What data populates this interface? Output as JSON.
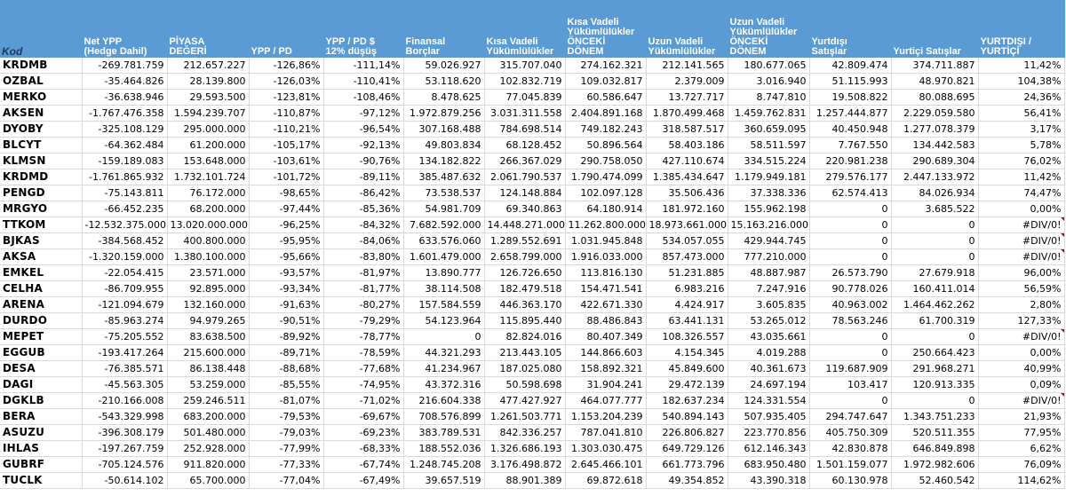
{
  "headers": [
    "Kod",
    "Net YPP\n(Hedge Dahil)",
    "PİYASA\nDEĞERİ",
    "YPP / PD",
    "YPP / PD $\n12% düşüş",
    "Finansal\nBorçlar",
    "Kısa Vadeli\nYükümlülükler",
    "Kısa Vadeli\nYükümlülükler\nÖNCEKİ\nDÖNEM",
    "Uzun Vadeli\nYükümlülükler",
    "Uzun Vadeli\nYükümlülükler\nÖNCEKİ\nDÖNEM",
    "Yurtdışı\nSatışlar",
    "Yurtiçi Satışlar",
    "YURTDIŞI /\nYURTİÇİ"
  ],
  "rows": [
    [
      "KRDMB",
      "-269.781.759",
      "212.657.227",
      "-126,86%",
      "-111,14%",
      "59.026.927",
      "315.707.040",
      "274.162.321",
      "212.141.565",
      "180.677.065",
      "42.809.474",
      "374.711.887",
      "11,42%"
    ],
    [
      "OZBAL",
      "-35.464.826",
      "28.139.800",
      "-126,03%",
      "-110,41%",
      "53.118.620",
      "102.832.719",
      "109.032.817",
      "2.379.009",
      "3.016.940",
      "51.115.993",
      "48.970.821",
      "104,38%"
    ],
    [
      "MERKO",
      "-36.638.946",
      "29.593.500",
      "-123,81%",
      "-108,46%",
      "8.478.625",
      "77.045.839",
      "60.586.647",
      "13.727.717",
      "8.747.810",
      "19.508.822",
      "80.088.695",
      "24,36%"
    ],
    [
      "AKSEN",
      "-1.767.476.358",
      "1.594.239.707",
      "-110,87%",
      "-97,12%",
      "1.972.879.256",
      "3.031.311.558",
      "2.404.891.168",
      "1.870.499.468",
      "1.459.762.831",
      "1.257.444.877",
      "2.229.059.580",
      "56,41%"
    ],
    [
      "DYOBY",
      "-325.108.129",
      "295.000.000",
      "-110,21%",
      "-96,54%",
      "307.168.488",
      "784.698.514",
      "749.182.243",
      "318.587.517",
      "360.659.095",
      "40.450.948",
      "1.277.078.379",
      "3,17%"
    ],
    [
      "BLCYT",
      "-64.362.484",
      "61.200.000",
      "-105,17%",
      "-92,13%",
      "49.803.834",
      "68.128.452",
      "50.896.564",
      "58.403.186",
      "58.511.597",
      "7.767.550",
      "134.442.583",
      "5,78%"
    ],
    [
      "KLMSN",
      "-159.189.083",
      "153.648.000",
      "-103,61%",
      "-90,76%",
      "134.182.822",
      "266.367.029",
      "290.758.050",
      "427.110.674",
      "334.515.224",
      "220.981.238",
      "290.689.304",
      "76,02%"
    ],
    [
      "KRDMD",
      "-1.761.865.932",
      "1.732.101.724",
      "-101,72%",
      "-89,11%",
      "385.487.632",
      "2.061.790.537",
      "1.790.474.099",
      "1.385.434.647",
      "1.179.949.181",
      "279.576.177",
      "2.447.133.972",
      "11,42%"
    ],
    [
      "PENGD",
      "-75.143.811",
      "76.172.000",
      "-98,65%",
      "-86,42%",
      "73.538.537",
      "124.148.884",
      "102.097.128",
      "35.506.436",
      "37.338.336",
      "62.574.413",
      "84.026.934",
      "74,47%"
    ],
    [
      "MRGYO",
      "-66.452.235",
      "68.200.000",
      "-97,44%",
      "-85,36%",
      "54.981.709",
      "69.340.863",
      "64.180.914",
      "181.972.160",
      "155.962.198",
      "0",
      "3.685.522",
      "0,00%"
    ],
    [
      "TTKOM",
      "-12.532.375.000",
      "13.020.000.000",
      "-96,25%",
      "-84,32%",
      "7.682.592.000",
      "14.448.271.000",
      "11.262.800.000",
      "18.973.661.000",
      "15.163.216.000",
      "0",
      "0",
      "#DIV/0!"
    ],
    [
      "BJKAS",
      "-384.568.452",
      "400.800.000",
      "-95,95%",
      "-84,06%",
      "633.576.060",
      "1.289.552.691",
      "1.031.945.848",
      "534.057.055",
      "429.944.745",
      "0",
      "0",
      "#DIV/0!"
    ],
    [
      "AKSA",
      "-1.320.159.000",
      "1.380.100.000",
      "-95,66%",
      "-83,80%",
      "1.601.479.000",
      "2.658.799.000",
      "1.916.033.000",
      "857.473.000",
      "777.210.000",
      "0",
      "0",
      "#DIV/0!"
    ],
    [
      "EMKEL",
      "-22.054.415",
      "23.571.000",
      "-93,57%",
      "-81,97%",
      "13.890.777",
      "126.726.650",
      "113.816.130",
      "51.231.885",
      "48.887.987",
      "26.573.790",
      "27.679.918",
      "96,00%"
    ],
    [
      "CELHA",
      "-86.709.955",
      "92.895.000",
      "-93,34%",
      "-81,77%",
      "38.114.508",
      "182.479.518",
      "154.471.541",
      "6.983.216",
      "7.247.916",
      "90.778.026",
      "160.411.014",
      "56,59%"
    ],
    [
      "ARENA",
      "-121.094.679",
      "132.160.000",
      "-91,63%",
      "-80,27%",
      "157.584.559",
      "446.363.170",
      "422.671.330",
      "4.424.917",
      "3.605.835",
      "40.963.002",
      "1.464.462.262",
      "2,80%"
    ],
    [
      "DURDO",
      "-85.963.274",
      "94.979.265",
      "-90,51%",
      "-79,29%",
      "54.123.964",
      "115.895.440",
      "88.486.843",
      "63.441.131",
      "53.265.012",
      "78.563.246",
      "61.700.319",
      "127,33%"
    ],
    [
      "MEPET",
      "-75.205.552",
      "83.638.500",
      "-89,92%",
      "-78,77%",
      "0",
      "82.824.016",
      "80.407.349",
      "108.326.557",
      "43.035.661",
      "0",
      "0",
      "#DIV/0!"
    ],
    [
      "EGGUB",
      "-193.417.264",
      "215.600.000",
      "-89,71%",
      "-78,59%",
      "44.321.293",
      "213.443.105",
      "144.866.603",
      "4.154.345",
      "4.019.288",
      "0",
      "250.664.423",
      "0,00%"
    ],
    [
      "DESA",
      "-76.385.571",
      "86.138.448",
      "-88,68%",
      "-77,68%",
      "41.234.967",
      "187.025.080",
      "158.892.321",
      "45.849.600",
      "40.361.673",
      "119.687.909",
      "291.968.271",
      "40,99%"
    ],
    [
      "DAGI",
      "-45.563.305",
      "53.259.000",
      "-85,55%",
      "-74,95%",
      "43.372.316",
      "50.598.698",
      "31.904.241",
      "29.472.139",
      "24.697.194",
      "103.417",
      "120.913.335",
      "0,09%"
    ],
    [
      "DGKLB",
      "-210.166.008",
      "259.246.511",
      "-81,07%",
      "-71,02%",
      "216.604.338",
      "477.427.927",
      "464.077.777",
      "182.637.234",
      "124.331.554",
      "0",
      "0",
      "#DIV/0!"
    ],
    [
      "BERA",
      "-543.329.998",
      "683.200.000",
      "-79,53%",
      "-69,67%",
      "708.576.899",
      "1.261.503.771",
      "1.153.204.239",
      "540.894.143",
      "507.935.405",
      "294.747.647",
      "1.343.751.233",
      "21,93%"
    ],
    [
      "ASUZU",
      "-396.308.179",
      "501.480.000",
      "-79,03%",
      "-69,23%",
      "383.789.531",
      "842.336.257",
      "787.041.810",
      "226.806.827",
      "223.770.856",
      "405.750.309",
      "520.511.355",
      "77,95%"
    ],
    [
      "IHLAS",
      "-197.267.759",
      "252.928.000",
      "-77,99%",
      "-68,33%",
      "188.552.036",
      "1.326.686.193",
      "1.303.030.475",
      "649.729.126",
      "612.146.343",
      "42.830.878",
      "646.849.898",
      "6,62%"
    ],
    [
      "GUBRF",
      "-705.124.576",
      "911.820.000",
      "-77,33%",
      "-67,74%",
      "1.248.745.208",
      "3.176.498.872",
      "2.645.466.101",
      "661.773.796",
      "683.950.480",
      "1.501.159.077",
      "1.972.982.606",
      "76,09%"
    ],
    [
      "TUCLK",
      "-50.614.102",
      "65.700.000",
      "-77,04%",
      "-67,49%",
      "39.657.519",
      "88.901.389",
      "69.872.618",
      "49.354.852",
      "43.390.318",
      "60.130.978",
      "52.460.542",
      "114,62%"
    ]
  ],
  "colors": {
    "header_bg": "#5B9BD5",
    "header_text": "#FFFFFF",
    "kod_header_text": "#1F3864",
    "error_marker": "#C00000",
    "grid": "#D9D9D9"
  }
}
